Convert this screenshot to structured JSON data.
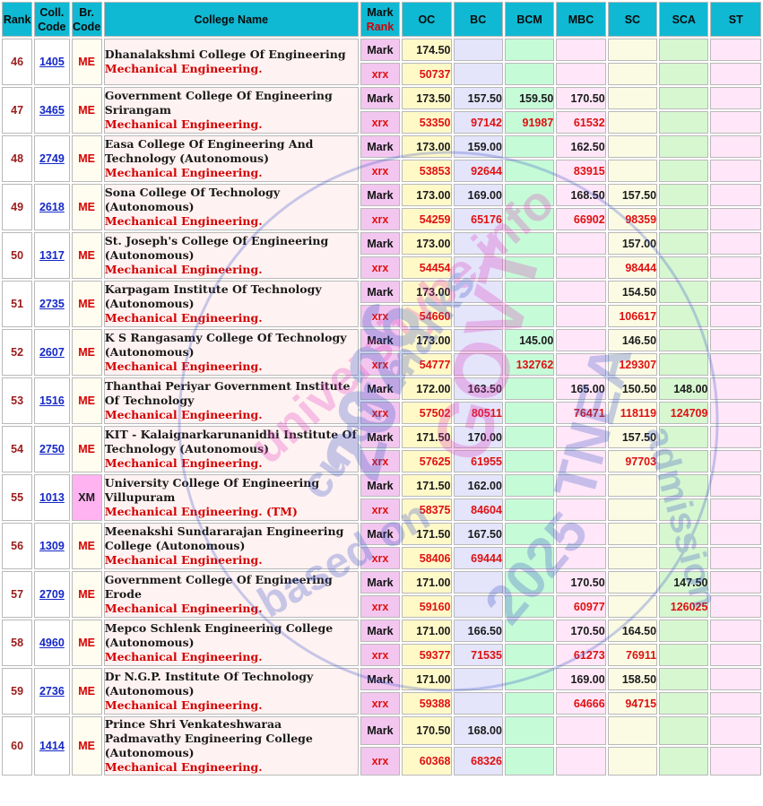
{
  "headers": {
    "rank": "Rank",
    "coll_code": "Coll. Code",
    "br_code": "Br. Code",
    "college_name": "College Name",
    "mark": "Mark",
    "rank_sub": "Rank",
    "oc": "OC",
    "bc": "BC",
    "bcm": "BCM",
    "mbc": "MBC",
    "sc": "SC",
    "sca": "SCA",
    "st": "ST"
  },
  "labels": {
    "mark": "Mark",
    "rank": "xrx"
  },
  "rows": [
    {
      "rank": "46",
      "code": "1405",
      "br": "ME",
      "college": "Dhanalakshmi College Of Engineering",
      "branch": "Mechanical Engineering.",
      "marks": {
        "oc": "174.50",
        "bc": "",
        "bcm": "",
        "mbc": "",
        "sc": "",
        "sca": "",
        "st": ""
      },
      "ranks": {
        "oc": "50737",
        "bc": "",
        "bcm": "",
        "mbc": "",
        "sc": "",
        "sca": "",
        "st": ""
      }
    },
    {
      "rank": "47",
      "code": "3465",
      "br": "ME",
      "college": "Government College Of Engineering Srirangam",
      "branch": "Mechanical Engineering.",
      "marks": {
        "oc": "173.50",
        "bc": "157.50",
        "bcm": "159.50",
        "mbc": "170.50",
        "sc": "",
        "sca": "",
        "st": ""
      },
      "ranks": {
        "oc": "53350",
        "bc": "97142",
        "bcm": "91987",
        "mbc": "61532",
        "sc": "",
        "sca": "",
        "st": ""
      }
    },
    {
      "rank": "48",
      "code": "2749",
      "br": "ME",
      "college": "Easa College Of Engineering And Technology (Autonomous)",
      "branch": "Mechanical Engineering.",
      "marks": {
        "oc": "173.00",
        "bc": "159.00",
        "bcm": "",
        "mbc": "162.50",
        "sc": "",
        "sca": "",
        "st": ""
      },
      "ranks": {
        "oc": "53853",
        "bc": "92644",
        "bcm": "",
        "mbc": "83915",
        "sc": "",
        "sca": "",
        "st": ""
      }
    },
    {
      "rank": "49",
      "code": "2618",
      "br": "ME",
      "college": "Sona College Of Technology (Autonomous)",
      "branch": "Mechanical Engineering.",
      "marks": {
        "oc": "173.00",
        "bc": "169.00",
        "bcm": "",
        "mbc": "168.50",
        "sc": "157.50",
        "sca": "",
        "st": ""
      },
      "ranks": {
        "oc": "54259",
        "bc": "65176",
        "bcm": "",
        "mbc": "66902",
        "sc": "98359",
        "sca": "",
        "st": ""
      }
    },
    {
      "rank": "50",
      "code": "1317",
      "br": "ME",
      "college": "St. Joseph's College Of Engineering (Autonomous)",
      "branch": "Mechanical Engineering.",
      "marks": {
        "oc": "173.00",
        "bc": "",
        "bcm": "",
        "mbc": "",
        "sc": "157.00",
        "sca": "",
        "st": ""
      },
      "ranks": {
        "oc": "54454",
        "bc": "",
        "bcm": "",
        "mbc": "",
        "sc": "98444",
        "sca": "",
        "st": ""
      }
    },
    {
      "rank": "51",
      "code": "2735",
      "br": "ME",
      "college": "Karpagam Institute Of Technology (Autonomous)",
      "branch": "Mechanical Engineering.",
      "marks": {
        "oc": "173.00",
        "bc": "",
        "bcm": "",
        "mbc": "",
        "sc": "154.50",
        "sca": "",
        "st": ""
      },
      "ranks": {
        "oc": "54660",
        "bc": "",
        "bcm": "",
        "mbc": "",
        "sc": "106617",
        "sca": "",
        "st": ""
      }
    },
    {
      "rank": "52",
      "code": "2607",
      "br": "ME",
      "college": "K S Rangasamy College Of Technology (Autonomous)",
      "branch": "Mechanical Engineering.",
      "marks": {
        "oc": "173.00",
        "bc": "",
        "bcm": "145.00",
        "mbc": "",
        "sc": "146.50",
        "sca": "",
        "st": ""
      },
      "ranks": {
        "oc": "54777",
        "bc": "",
        "bcm": "132762",
        "mbc": "",
        "sc": "129307",
        "sca": "",
        "st": ""
      }
    },
    {
      "rank": "53",
      "code": "1516",
      "br": "ME",
      "college": "Thanthai Periyar Government Institute Of Technology",
      "branch": "Mechanical Engineering.",
      "marks": {
        "oc": "172.00",
        "bc": "163.50",
        "bcm": "",
        "mbc": "165.00",
        "sc": "150.50",
        "sca": "148.00",
        "st": ""
      },
      "ranks": {
        "oc": "57502",
        "bc": "80511",
        "bcm": "",
        "mbc": "76471",
        "sc": "118119",
        "sca": "124709",
        "st": ""
      }
    },
    {
      "rank": "54",
      "code": "2750",
      "br": "ME",
      "college": "KIT - Kalaignarkarunanidhi Institute Of Technology (Autonomous)",
      "branch": "Mechanical Engineering.",
      "marks": {
        "oc": "171.50",
        "bc": "170.00",
        "bcm": "",
        "mbc": "",
        "sc": "157.50",
        "sca": "",
        "st": ""
      },
      "ranks": {
        "oc": "57625",
        "bc": "61955",
        "bcm": "",
        "mbc": "",
        "sc": "97703",
        "sca": "",
        "st": ""
      }
    },
    {
      "rank": "55",
      "code": "1013",
      "br": "XM",
      "college": "University College Of Engineering Villupuram",
      "branch": "Mechanical Engineering. (TM)",
      "marks": {
        "oc": "171.50",
        "bc": "162.00",
        "bcm": "",
        "mbc": "",
        "sc": "",
        "sca": "",
        "st": ""
      },
      "ranks": {
        "oc": "58375",
        "bc": "84604",
        "bcm": "",
        "mbc": "",
        "sc": "",
        "sca": "",
        "st": ""
      }
    },
    {
      "rank": "56",
      "code": "1309",
      "br": "ME",
      "college": "Meenakshi Sundararajan Engineering College (Autonomous)",
      "branch": "Mechanical Engineering.",
      "marks": {
        "oc": "171.50",
        "bc": "167.50",
        "bcm": "",
        "mbc": "",
        "sc": "",
        "sca": "",
        "st": ""
      },
      "ranks": {
        "oc": "58406",
        "bc": "69444",
        "bcm": "",
        "mbc": "",
        "sc": "",
        "sca": "",
        "st": ""
      }
    },
    {
      "rank": "57",
      "code": "2709",
      "br": "ME",
      "college": "Government College Of Engineering Erode",
      "branch": "Mechanical Engineering.",
      "marks": {
        "oc": "171.00",
        "bc": "",
        "bcm": "",
        "mbc": "170.50",
        "sc": "",
        "sca": "147.50",
        "st": ""
      },
      "ranks": {
        "oc": "59160",
        "bc": "",
        "bcm": "",
        "mbc": "60977",
        "sc": "",
        "sca": "126025",
        "st": ""
      }
    },
    {
      "rank": "58",
      "code": "4960",
      "br": "ME",
      "college": "Mepco Schlenk Engineering College (Autonomous)",
      "branch": "Mechanical Engineering.",
      "marks": {
        "oc": "171.00",
        "bc": "166.50",
        "bcm": "",
        "mbc": "170.50",
        "sc": "164.50",
        "sca": "",
        "st": ""
      },
      "ranks": {
        "oc": "59377",
        "bc": "71535",
        "bcm": "",
        "mbc": "61273",
        "sc": "76911",
        "sca": "",
        "st": ""
      }
    },
    {
      "rank": "59",
      "code": "2736",
      "br": "ME",
      "college": "Dr N.G.P. Institute Of Technology (Autonomous)",
      "branch": "Mechanical Engineering.",
      "marks": {
        "oc": "171.00",
        "bc": "",
        "bcm": "",
        "mbc": "169.00",
        "sc": "158.50",
        "sca": "",
        "st": ""
      },
      "ranks": {
        "oc": "59388",
        "bc": "",
        "bcm": "",
        "mbc": "64666",
        "sc": "94715",
        "sca": "",
        "st": ""
      }
    },
    {
      "rank": "60",
      "code": "1414",
      "br": "ME",
      "college": "Prince Shri Venkateshwaraa Padmavathy Engineering College (Autonomous)",
      "branch": "Mechanical Engineering.",
      "marks": {
        "oc": "170.50",
        "bc": "168.00",
        "bcm": "",
        "mbc": "",
        "sc": "",
        "sca": "",
        "st": ""
      },
      "ranks": {
        "oc": "60368",
        "bc": "68326",
        "bcm": "",
        "mbc": "",
        "sc": "",
        "sca": "",
        "st": ""
      }
    }
  ],
  "watermark": {
    "lines": [
      "universitybe.info",
      "cutoff marks",
      "2026",
      "GOVT",
      "TNEA",
      "2025",
      "admission",
      "based on"
    ]
  },
  "colors": {
    "header_bg": "#0fb9d3",
    "rank_text": "#9b1c1c",
    "branch_red": "#d40000",
    "link_blue": "#1428c8",
    "oc_col": "#fff9c8",
    "bc_col": "#e4e4fb",
    "bcm_col": "#c6fbd8",
    "mbc_col": "#ffe6f8",
    "sc_col": "#fbfbe4",
    "sca_col": "#d6f7d0",
    "st_col": "#ffe6f8"
  }
}
